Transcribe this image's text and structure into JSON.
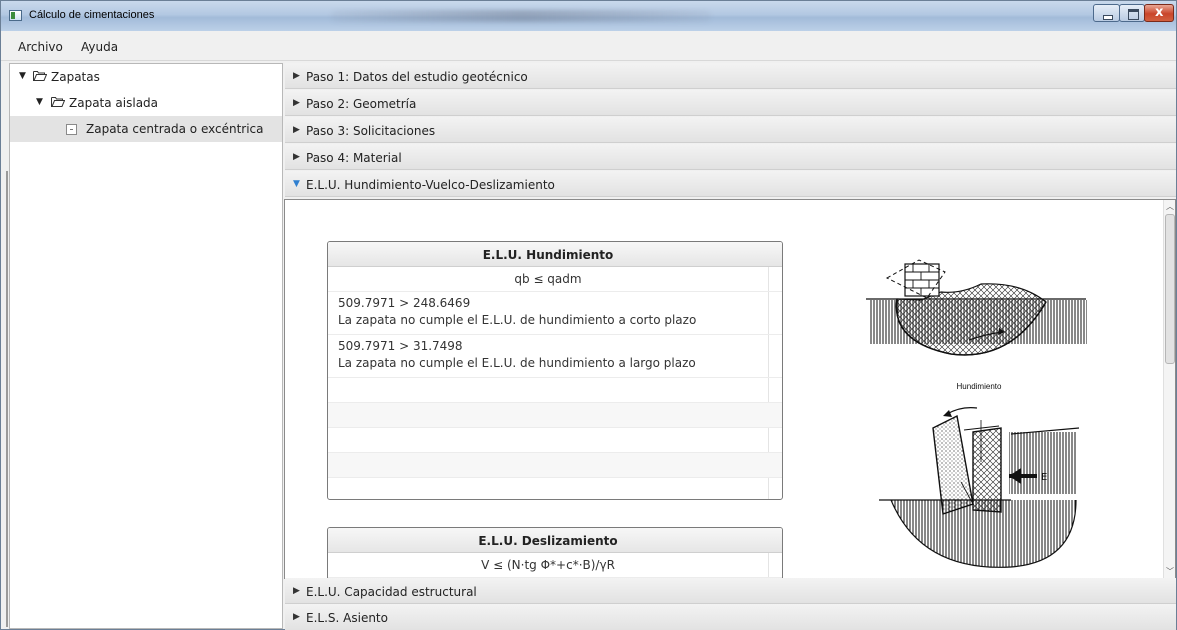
{
  "window": {
    "title": "Cálculo de cimentaciones",
    "close_glyph": "x"
  },
  "menu": {
    "items": [
      "Archivo",
      "Ayuda"
    ]
  },
  "tree": {
    "items": [
      {
        "label": "Zapatas",
        "icon": "folder-open-icon",
        "level": 0
      },
      {
        "label": "Zapata aislada",
        "icon": "folder-open-icon",
        "level": 1
      },
      {
        "label": "Zapata centrada o excéntrica",
        "icon": "document-icon",
        "level": 2,
        "selected": true
      }
    ]
  },
  "accordion": {
    "panes": [
      {
        "label": "Paso 1: Datos del estudio geotécnico",
        "expanded": false
      },
      {
        "label": "Paso 2: Geometría",
        "expanded": false
      },
      {
        "label": "Paso 3: Solicitaciones",
        "expanded": false
      },
      {
        "label": "Paso 4: Material",
        "expanded": false
      },
      {
        "label": "E.L.U. Hundimiento-Vuelco-Deslizamiento",
        "expanded": true
      },
      {
        "label": "E.L.U. Capacidad estructural",
        "expanded": false
      },
      {
        "label": "E.L.S. Asiento",
        "expanded": false
      }
    ],
    "arrow_closed": "▶",
    "arrow_open": "▼"
  },
  "hundimiento": {
    "title": "E.L.U. Hundimiento",
    "formula": "qb ≤ qadm",
    "results": [
      {
        "comparison": "509.7971 > 248.6469",
        "message": "La zapata no cumple el E.L.U. de hundimiento a corto plazo"
      },
      {
        "comparison": "509.7971 > 31.7498",
        "message": "La zapata no cumple el E.L.U. de hundimiento a largo plazo"
      }
    ]
  },
  "deslizamiento": {
    "title": "E.L.U. Deslizamiento",
    "formula": "V ≤ (N·tg Φ*+c*·B)/γR"
  },
  "illustration": {
    "caption": "Hundimiento",
    "vuelco_label": "E"
  },
  "colors": {
    "open_arrow": "#2f7fd0",
    "selected_row": "#e3e3e3"
  }
}
